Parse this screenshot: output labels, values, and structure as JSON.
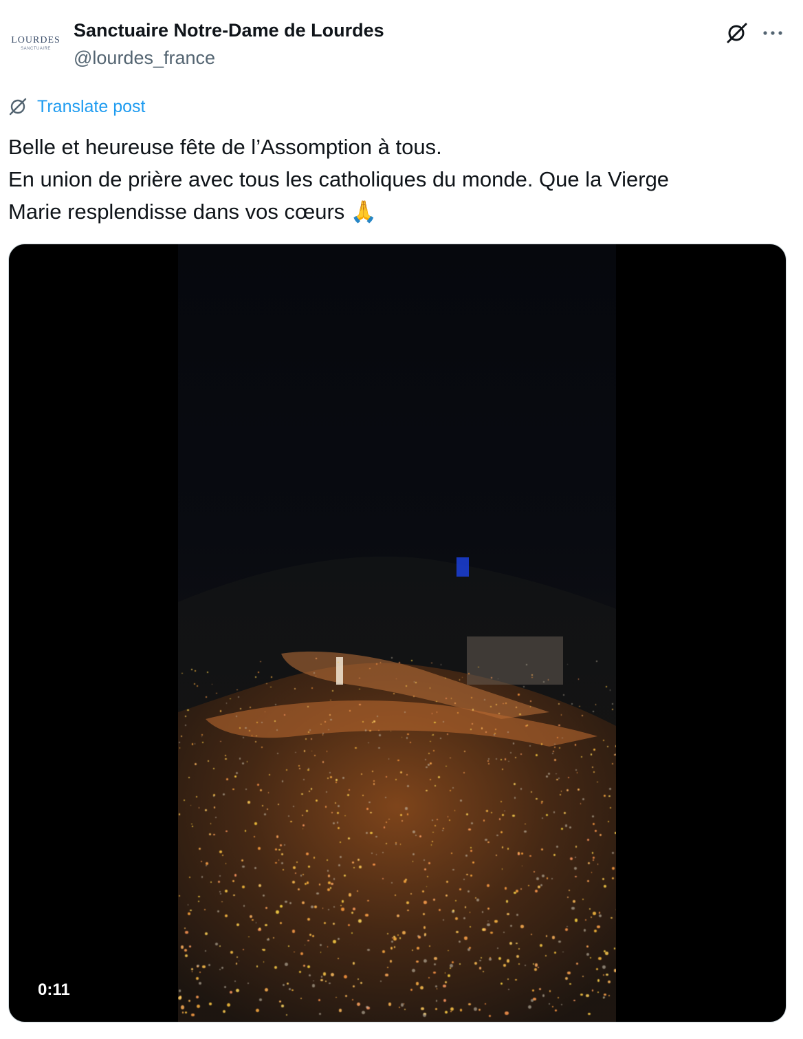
{
  "author": {
    "display_name": "Sanctuaire Notre-Dame de Lourdes",
    "handle": "@lourdes_france",
    "avatar_logo_text": "LOURDES",
    "avatar_logo_sub": "SANCTUAIRE"
  },
  "header_icons": [
    "grok-icon",
    "more-icon"
  ],
  "translate": {
    "label": "Translate post",
    "icon": "translate-icon"
  },
  "tweet": {
    "lines": [
      "Belle et heureuse fête de l’Assomption à tous.",
      "En union de prière avec tous les catholiques du monde. Que la Vierge",
      "Marie resplendisse dans vos cœurs 🙏"
    ]
  },
  "media": {
    "type": "video",
    "duration": "0:11"
  },
  "colors": {
    "accent": "#1d9bf0",
    "text_primary": "#0f1419",
    "text_secondary": "#536471",
    "border": "#cfd9de"
  }
}
